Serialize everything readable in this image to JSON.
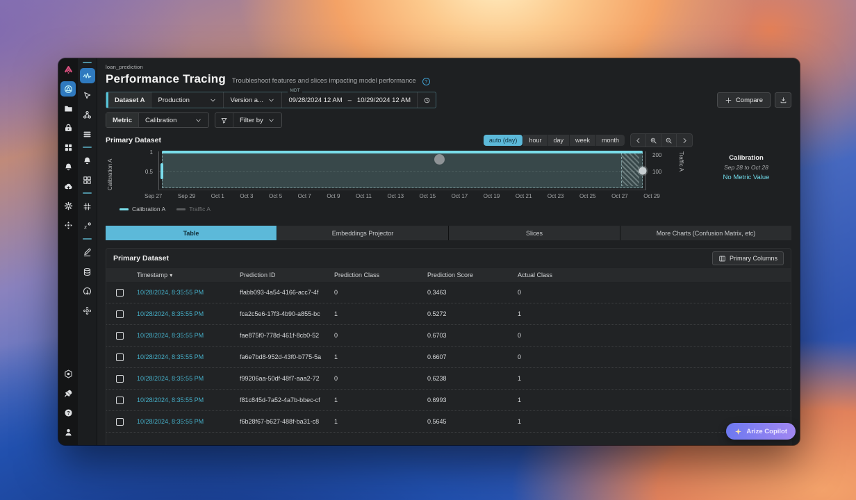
{
  "colors": {
    "accent_cyan": "#5cb9d9",
    "link_teal": "#45aec7",
    "no_metric_value_teal": "#6fd9e8",
    "brand_pink": "#d94f7e",
    "copilot_gradient": [
      "#6d79f0",
      "#a187f2"
    ],
    "active_sidebar_blue": "#2f7abf"
  },
  "sidebar": {
    "outer_top": [
      {
        "icon": "arize-logo-icon"
      },
      {
        "icon": "spaces-globe-icon",
        "active": true
      },
      {
        "icon": "folder-icon"
      },
      {
        "icon": "lock-case-icon"
      },
      {
        "icon": "apps-grid-icon"
      },
      {
        "icon": "bell-icon"
      },
      {
        "icon": "cloud-upload-icon"
      },
      {
        "icon": "settings-gear-icon"
      },
      {
        "icon": "deploy-arrows-icon"
      }
    ],
    "outer_bottom": [
      {
        "icon": "copilot-hexagon-icon"
      },
      {
        "icon": "rocket-icon"
      },
      {
        "icon": "help-icon"
      },
      {
        "icon": "user-icon"
      }
    ],
    "inner": [
      {
        "divider": true
      },
      {
        "icon": "performance-tracing-icon",
        "active": true
      },
      {
        "icon": "cursor-icon"
      },
      {
        "icon": "graph-nodes-icon"
      },
      {
        "icon": "layers-icon"
      },
      {
        "divider": true
      },
      {
        "icon": "bell-icon"
      },
      {
        "icon": "dashboard-grid-icon"
      },
      {
        "divider": true
      },
      {
        "icon": "slack-icon"
      },
      {
        "icon": "formula-icon"
      },
      {
        "divider": true
      },
      {
        "icon": "pencil-icon"
      },
      {
        "icon": "database-icon"
      },
      {
        "icon": "import-circle-icon"
      },
      {
        "icon": "flower-gear-icon"
      }
    ]
  },
  "header": {
    "breadcrumb": "loan_prediction",
    "title": "Performance Tracing",
    "subtitle": "Troubleshoot features and slices impacting model performance",
    "help": "?"
  },
  "dataset_bar": {
    "dataset_label": "Dataset A",
    "environment": "Production",
    "version": "Version a...",
    "timezone": "MDT",
    "date_start": "09/28/2024 12 AM",
    "date_separator": "–",
    "date_end": "10/29/2024 12 AM",
    "compare_label": "Compare"
  },
  "metric_bar": {
    "metric_label": "Metric",
    "metric_value": "Calibration",
    "filter_label": "Filter by"
  },
  "chart": {
    "section_title": "Primary Dataset",
    "granularity": [
      {
        "label": "auto (day)",
        "active": true
      },
      {
        "label": "hour"
      },
      {
        "label": "day"
      },
      {
        "label": "week"
      },
      {
        "label": "month"
      }
    ],
    "y_left": {
      "label": "Calibration A",
      "ticks": [
        "1",
        "0.5"
      ]
    },
    "y_right": {
      "label": "Traffic A",
      "ticks": [
        "200",
        "100"
      ]
    },
    "x_ticks": [
      "Sep 27",
      "Sep 29",
      "Oct 1",
      "Oct 3",
      "Oct 5",
      "Oct 7",
      "Oct 9",
      "Oct 11",
      "Oct 13",
      "Oct 15",
      "Oct 17",
      "Oct 19",
      "Oct 21",
      "Oct 23",
      "Oct 25",
      "Oct 27",
      "Oct 29"
    ],
    "legend": [
      {
        "label": "Calibration A"
      },
      {
        "label": "Traffic A",
        "muted": true
      }
    ],
    "selection": {
      "start": "Sep 28",
      "end": "Oct 28",
      "calibration_value": 1
    },
    "info": {
      "metric": "Calibration",
      "range": "Sep 28 to Oct 28",
      "value": "No Metric Value"
    }
  },
  "tabs": [
    {
      "label": "Table",
      "active": true
    },
    {
      "label": "Embeddings Projector"
    },
    {
      "label": "Slices"
    },
    {
      "label": "More Charts (Confusion Matrix, etc)"
    }
  ],
  "table": {
    "section_title": "Primary Dataset",
    "columns_button": "Primary Columns",
    "headers": [
      "Timestamp",
      "Prediction ID",
      "Prediction Class",
      "Prediction Score",
      "Actual Class"
    ],
    "rows": [
      {
        "timestamp": "10/28/2024, 8:35:55 PM",
        "prediction_id": "ffabb093-4a54-4166-acc7-4f",
        "prediction_class": "0",
        "prediction_score": "0.3463",
        "actual_class": "0"
      },
      {
        "timestamp": "10/28/2024, 8:35:55 PM",
        "prediction_id": "fca2c5e6-17f3-4b90-a855-bc",
        "prediction_class": "1",
        "prediction_score": "0.5272",
        "actual_class": "1"
      },
      {
        "timestamp": "10/28/2024, 8:35:55 PM",
        "prediction_id": "fae875f0-778d-461f-8cb0-52",
        "prediction_class": "0",
        "prediction_score": "0.6703",
        "actual_class": "0"
      },
      {
        "timestamp": "10/28/2024, 8:35:55 PM",
        "prediction_id": "fa6e7bd8-952d-43f0-b775-5a",
        "prediction_class": "1",
        "prediction_score": "0.6607",
        "actual_class": "0"
      },
      {
        "timestamp": "10/28/2024, 8:35:55 PM",
        "prediction_id": "f99206aa-50df-48f7-aaa2-72",
        "prediction_class": "0",
        "prediction_score": "0.6238",
        "actual_class": "1"
      },
      {
        "timestamp": "10/28/2024, 8:35:55 PM",
        "prediction_id": "f81c845d-7a52-4a7b-bbec-cf",
        "prediction_class": "1",
        "prediction_score": "0.6993",
        "actual_class": "1"
      },
      {
        "timestamp": "10/28/2024, 8:35:55 PM",
        "prediction_id": "f6b28f67-b627-488f-ba31-c8",
        "prediction_class": "1",
        "prediction_score": "0.5645",
        "actual_class": "1"
      }
    ]
  },
  "copilot": {
    "label": "Arize Copilot"
  }
}
